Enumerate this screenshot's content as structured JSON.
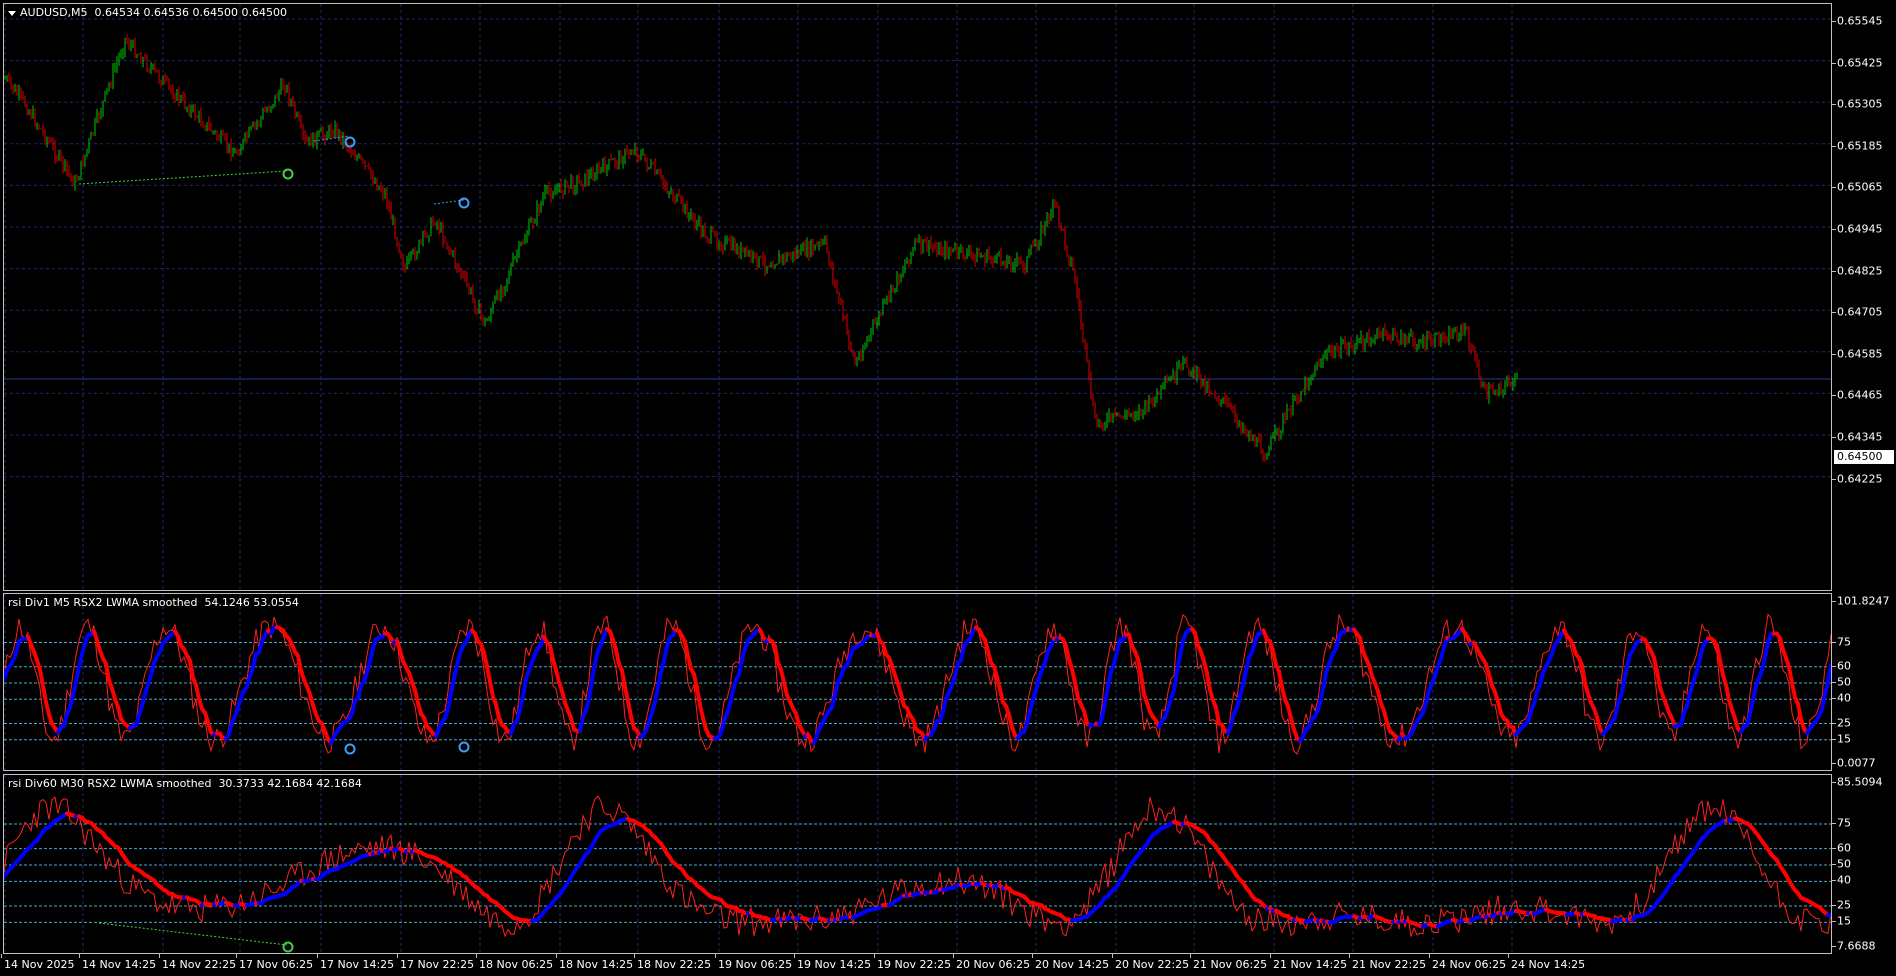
{
  "main_chart": {
    "symbol_label": "AUDUSD,M5",
    "ohlc_label": "0.64534 0.64536 0.64500 0.64500",
    "price_axis": [
      "0.65545",
      "0.65425",
      "0.65305",
      "0.65185",
      "0.65065",
      "0.64945",
      "0.64825",
      "0.64705",
      "0.64585",
      "0.64465",
      "0.64345",
      "0.64225"
    ],
    "current_price": "0.64500",
    "colors": {
      "bull": "#00c800",
      "bear": "#e00000",
      "grid": "#1c2a6a",
      "frame": "#c0c0c0",
      "signal": "#3aa0ff"
    }
  },
  "rsi_panel_1": {
    "title": "rsi Div1 M5 RSX2 LWMA smoothed",
    "values": "54.1246 53.0554",
    "axis_labels": [
      "101.8247",
      "75",
      "60",
      "50",
      "40",
      "25",
      "15",
      "0.0077"
    ],
    "colors": {
      "up": "#0000ff",
      "down": "#ff0000",
      "levels": "#4aa8c8"
    }
  },
  "rsi_panel_2": {
    "title": "rsi Div60 M30 RSX2 LWMA smoothed",
    "values": "30.3733 42.1684 42.1684",
    "axis_labels": [
      "85.5094",
      "75",
      "60",
      "50",
      "40",
      "25",
      "15",
      "7.6688"
    ],
    "colors": {
      "up": "#0000ff",
      "down": "#ff0000",
      "levels": "#4aa8c8"
    }
  },
  "time_axis": [
    "14 Nov 2025",
    "14 Nov 14:25",
    "14 Nov 22:25",
    "17 Nov 06:25",
    "17 Nov 14:25",
    "17 Nov 22:25",
    "18 Nov 06:25",
    "18 Nov 14:25",
    "18 Nov 22:25",
    "19 Nov 06:25",
    "19 Nov 14:25",
    "19 Nov 22:25",
    "20 Nov 06:25",
    "20 Nov 14:25",
    "20 Nov 22:25",
    "21 Nov 06:25",
    "21 Nov 14:25",
    "21 Nov 22:25",
    "24 Nov 06:25",
    "24 Nov 14:25"
  ]
}
